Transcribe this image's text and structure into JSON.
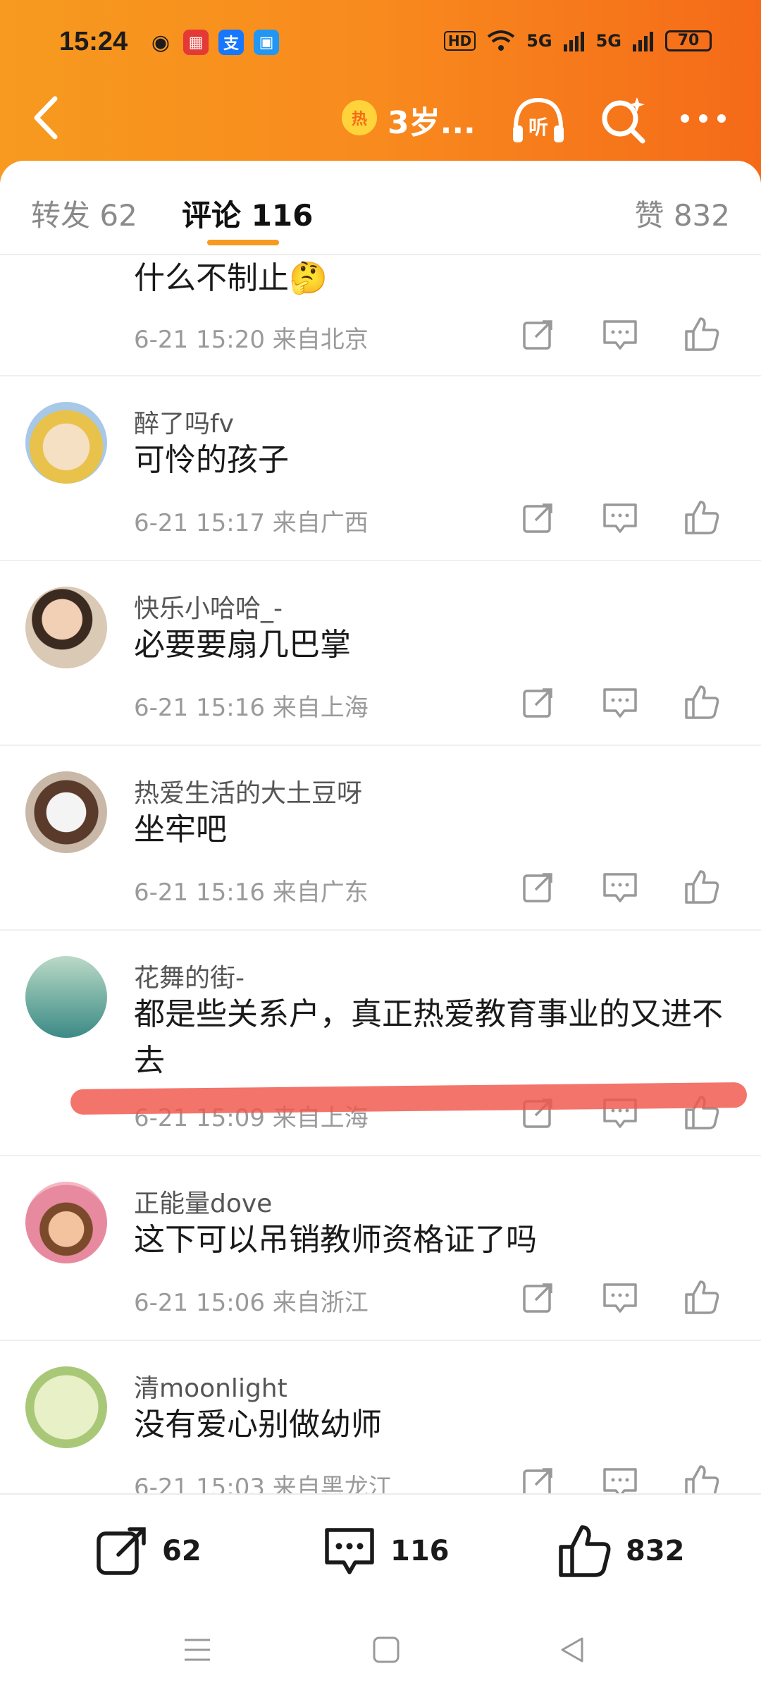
{
  "status_bar": {
    "time": "15:24",
    "apps": [
      {
        "icon": "weibo-icon",
        "glyph": "◉",
        "color": "#e6162d"
      },
      {
        "icon": "app-red-icon",
        "glyph": "器",
        "color": "#e53935"
      },
      {
        "icon": "alipay-icon",
        "glyph": "支",
        "color": "#1677ff"
      },
      {
        "icon": "app-blue-icon",
        "glyph": "▣",
        "color": "#2196f3"
      }
    ],
    "hd": "HD",
    "signal1": "5G",
    "signal2": "5G",
    "battery": "70"
  },
  "nav": {
    "hot_badge": "热",
    "title": "3岁..."
  },
  "tabs": {
    "repost": "转发 62",
    "comments": "评论 116",
    "likes": "赞 832"
  },
  "comments": [
    {
      "name": "",
      "text": "什么不制止🤔",
      "meta": "6-21 15:20  来自北京"
    },
    {
      "name": "醉了吗fv",
      "text": "可怜的孩子",
      "meta": "6-21 15:17  来自广西"
    },
    {
      "name": "快乐小哈哈_-",
      "text": "必要要扇几巴掌",
      "meta": "6-21 15:16  来自上海"
    },
    {
      "name": "热爱生活的大土豆呀",
      "text": "坐牢吧",
      "meta": "6-21 15:16  来自广东"
    },
    {
      "name": "花舞的街-",
      "text": "都是些关系户，真正热爱教育事业的又进不去",
      "meta": "6-21 15:09  来自上海"
    },
    {
      "name": "正能量dove",
      "text": "这下可以吊销教师资格证了吗",
      "meta": "6-21 15:06  来自浙江"
    },
    {
      "name": "清moonlight",
      "text": "没有爱心别做幼师",
      "meta": "6-21 15:03  来自黑龙江"
    }
  ],
  "bottom_bar": {
    "repost_count": "62",
    "comment_count": "116",
    "like_count": "832"
  },
  "colors": {
    "header_start": "#f79a1f",
    "header_end": "#f56a18",
    "tab_indicator": "#f79a1f",
    "annotation_red": "#f0554b"
  }
}
